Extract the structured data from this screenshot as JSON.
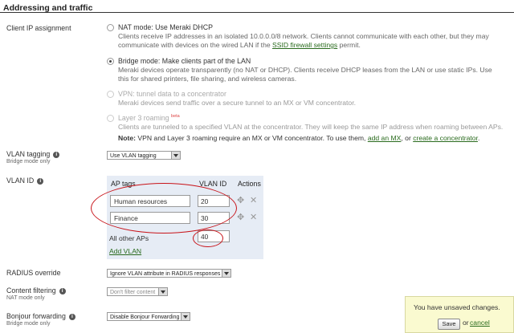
{
  "section": {
    "title": "Addressing and traffic"
  },
  "client_ip": {
    "label": "Client IP assignment",
    "options": [
      {
        "title": "NAT mode: Use Meraki DHCP",
        "desc_pre": "Clients receive IP addresses in an isolated 10.0.0.0/8 network. Clients cannot communicate with each other, but they may communicate with devices on the wired LAN if the ",
        "desc_link": "SSID firewall settings",
        "desc_post": " permit.",
        "checked": false,
        "disabled": false
      },
      {
        "title": "Bridge mode: Make clients part of the LAN",
        "desc": "Meraki devices operate transparently (no NAT or DHCP). Clients receive DHCP leases from the LAN or use static IPs. Use this for shared printers, file sharing, and wireless cameras.",
        "checked": true,
        "disabled": false
      },
      {
        "title": "VPN: tunnel data to a concentrator",
        "desc": "Meraki devices send traffic over a secure tunnel to an MX or VM concentrator.",
        "checked": false,
        "disabled": true
      },
      {
        "title": "Layer 3 roaming",
        "badge": "beta",
        "desc": "Clients are tunneled to a specified VLAN at the concentrator. They will keep the same IP address when roaming between APs.",
        "checked": false,
        "disabled": true
      }
    ],
    "note_label": "Note:",
    "note_text": " VPN and Layer 3 roaming require an MX or VM concentrator. To use them, ",
    "note_link1": "add an MX",
    "note_mid": ", or ",
    "note_link2": "create a concentrator",
    "note_end": "."
  },
  "vlan_tagging": {
    "label": "VLAN tagging",
    "sublabel": "Bridge mode only",
    "value": "Use VLAN tagging"
  },
  "vlan_id": {
    "label": "VLAN ID",
    "headers": {
      "tags": "AP tags",
      "vlan": "VLAN ID",
      "actions": "Actions"
    },
    "rows": [
      {
        "tags": "Human resources",
        "vlan": "20"
      },
      {
        "tags": "Finance",
        "vlan": "30"
      }
    ],
    "other_label": "All other APs",
    "other_value": "40",
    "add_label": "Add VLAN"
  },
  "radius": {
    "label": "RADIUS override",
    "value": "Ignore VLAN attribute in RADIUS responses"
  },
  "content_filtering": {
    "label": "Content filtering",
    "sublabel": "NAT mode only",
    "value": "Don't filter content"
  },
  "bonjour": {
    "label": "Bonjour forwarding",
    "sublabel": "Bridge mode only",
    "value": "Disable Bonjour Forwarding"
  },
  "save_bar": {
    "message": "You have unsaved changes.",
    "save_label": "Save",
    "or_label": "or",
    "cancel_label": "cancel"
  },
  "colors": {
    "link": "#2a6b1e",
    "highlight": "#c8141a",
    "table_bg": "#e6ecf5",
    "save_bg": "#fafad0"
  },
  "icons": {
    "info": "info-icon",
    "move": "move-icon",
    "delete": "delete-icon",
    "dropdown": "chevron-down-icon"
  }
}
